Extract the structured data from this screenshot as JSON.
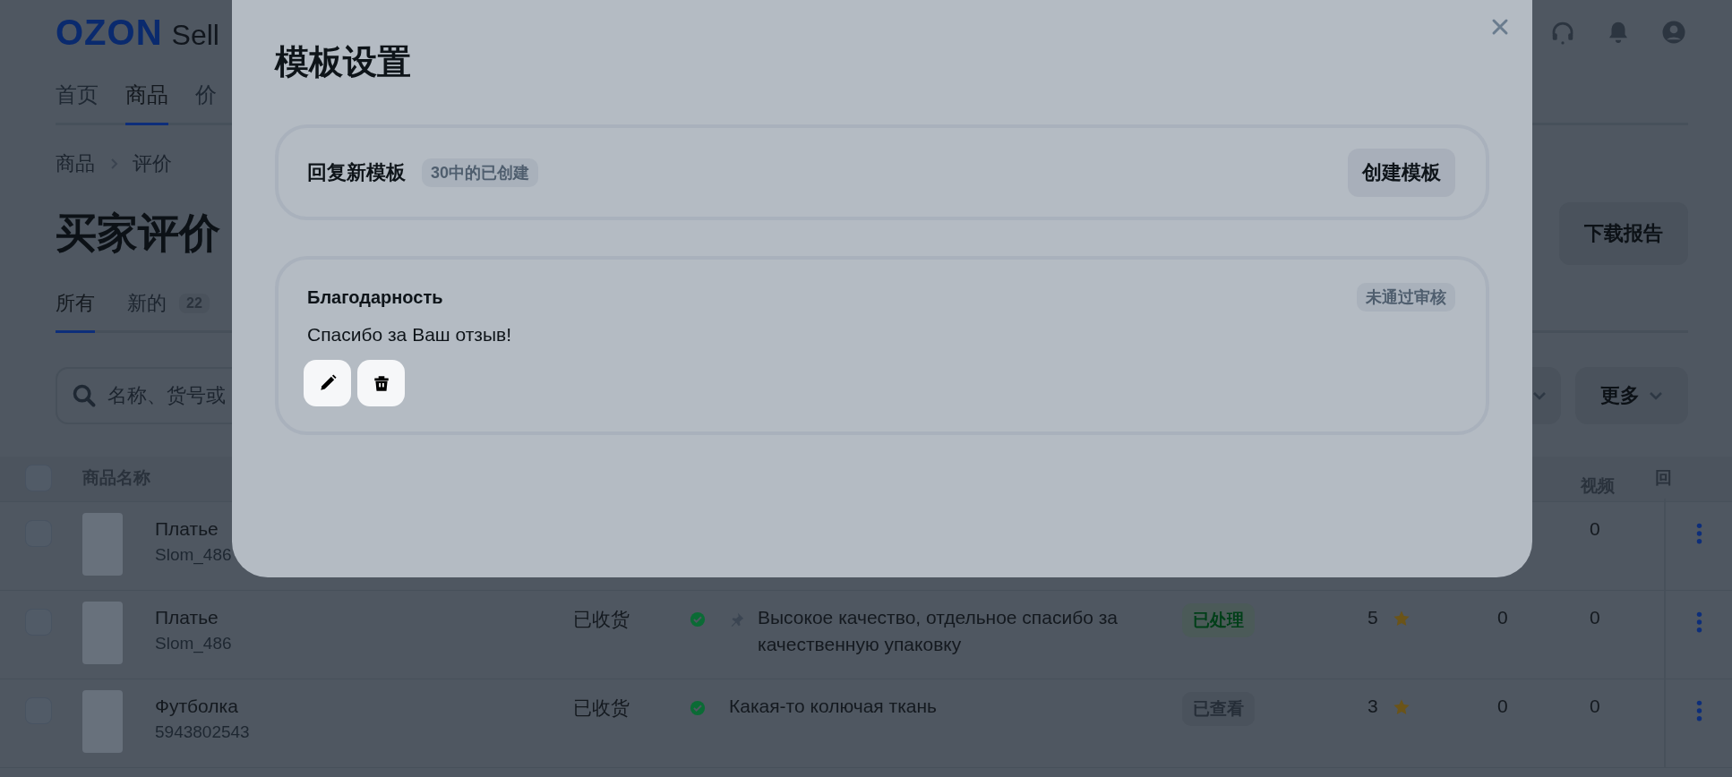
{
  "header": {
    "logo": "OZON",
    "logo_suffix": "Sell"
  },
  "nav": [
    {
      "label": "首页",
      "selected": false
    },
    {
      "label": "商品",
      "selected": true
    },
    {
      "label": "价",
      "selected": false
    }
  ],
  "breadcrumbs": [
    "商品",
    "评价"
  ],
  "page_title": "买家评价",
  "download_button": "下载报告",
  "tabs": [
    {
      "label": "所有",
      "selected": true
    },
    {
      "label": "新的",
      "count": "22",
      "selected": false
    }
  ],
  "search": {
    "placeholder": "名称、货号或"
  },
  "more_button": "更多",
  "table": {
    "header_checked": false,
    "columns": [
      "商品名称",
      "视频",
      "回"
    ],
    "rows": [
      {
        "checked": false,
        "name": "Платье",
        "sku": "Slom_486",
        "videos": "0"
      },
      {
        "checked": false,
        "name": "Платье",
        "sku": "Slom_486",
        "status": "已收货",
        "pinned": true,
        "text": "Высокое качество, отдельное спасибо за качественную упаковку",
        "badge": {
          "label": "已处理",
          "kind": "processed"
        },
        "rating": "5",
        "col_a": "0",
        "videos": "0"
      },
      {
        "checked": false,
        "name": "Футболка",
        "sku": "5943802543",
        "status": "已收货",
        "pinned": false,
        "text": "Какая-то колючая ткань",
        "badge": {
          "label": "已查看",
          "kind": "viewed"
        },
        "rating": "3",
        "col_a": "0",
        "videos": "0"
      }
    ]
  },
  "modal": {
    "title": "模板设置",
    "new_template": {
      "label": "回复新模板",
      "counter": "30中的已创建",
      "button": "创建模板"
    },
    "templates": [
      {
        "name": "Благодарность",
        "status": "未通过审核",
        "text": "Спасибо за Ваш отзыв!"
      }
    ]
  }
}
